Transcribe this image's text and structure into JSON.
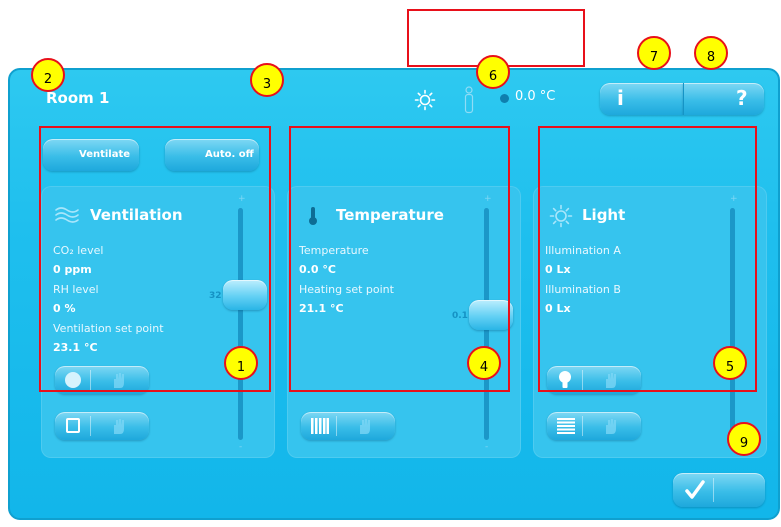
{
  "header": {
    "room_title": "Room 1",
    "temperature_readout": "0.0 °C",
    "info_button": "i",
    "help_button": "?"
  },
  "ventilation": {
    "ventilate_button": "Ventilate",
    "auto_off_button": "Auto. off",
    "title": "Ventilation",
    "co2_label": "CO₂ level",
    "co2_value": "0 ppm",
    "rh_label": "RH level",
    "rh_value": "0 %",
    "setpoint_label": "Ventilation set point",
    "setpoint_value": "23.1 °C",
    "slider_value": "32"
  },
  "temperature": {
    "title": "Temperature",
    "temp_label": "Temperature",
    "temp_value": "0.0 °C",
    "heating_label": "Heating set point",
    "heating_value": "21.1 °C",
    "slider_value": "0.1"
  },
  "light": {
    "title": "Light",
    "illum_a_label": "Illumination A",
    "illum_a_value": "0 Lx",
    "illum_b_label": "Illumination B",
    "illum_b_value": "0 Lx"
  },
  "slider_plus": "+",
  "slider_minus": "-",
  "markers": [
    "2",
    "3",
    "6",
    "7",
    "8",
    "1",
    "4",
    "5",
    "9"
  ],
  "colors": {
    "panel": "#1fbfee",
    "card": "#36c4ee",
    "annotation_box": "#e8101a",
    "marker_fill": "#ffff00"
  }
}
